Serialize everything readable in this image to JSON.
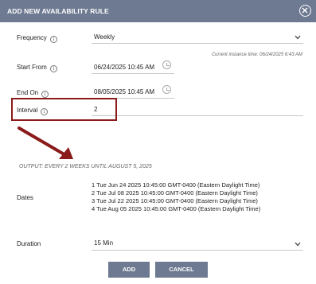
{
  "header": {
    "title": "ADD NEW AVAILABILITY RULE"
  },
  "fields": {
    "frequency": {
      "label": "Frequency",
      "value": "Weekly"
    },
    "instance_caption": "Current instance time: 06/24/2025 6:43 AM",
    "start_from": {
      "label": "Start From",
      "value": "06/24/2025 10:45 AM"
    },
    "end_on": {
      "label": "End On",
      "value": "08/05/2025 10:45 AM"
    },
    "interval": {
      "label": "Interval",
      "value": "2"
    },
    "dates": {
      "label": "Dates",
      "items": [
        "1 Tue Jun  24 2025 10:45:00 GMT-0400 (Eastern Daylight Time)",
        "2 Tue Jul   08 2025 10:45:00 GMT-0400 (Eastern Daylight Time)",
        "3 Tue Jul   22 2025 10:45:00 GMT-0400 (Eastern Daylight Time)",
        "4 Tue Aug 05 2025 10:45:00 GMT-0400 (Eastern Daylight Time)"
      ]
    },
    "duration": {
      "label": "Duration",
      "value": "15 Min"
    }
  },
  "output_text": "OUTPUT: EVERY 2 WEEKS UNTIL AUGUST 5, 2025",
  "buttons": {
    "add": "ADD",
    "cancel": "CANCEL"
  },
  "colors": {
    "header": "#6e7a91",
    "highlight": "#8b1a1a"
  }
}
